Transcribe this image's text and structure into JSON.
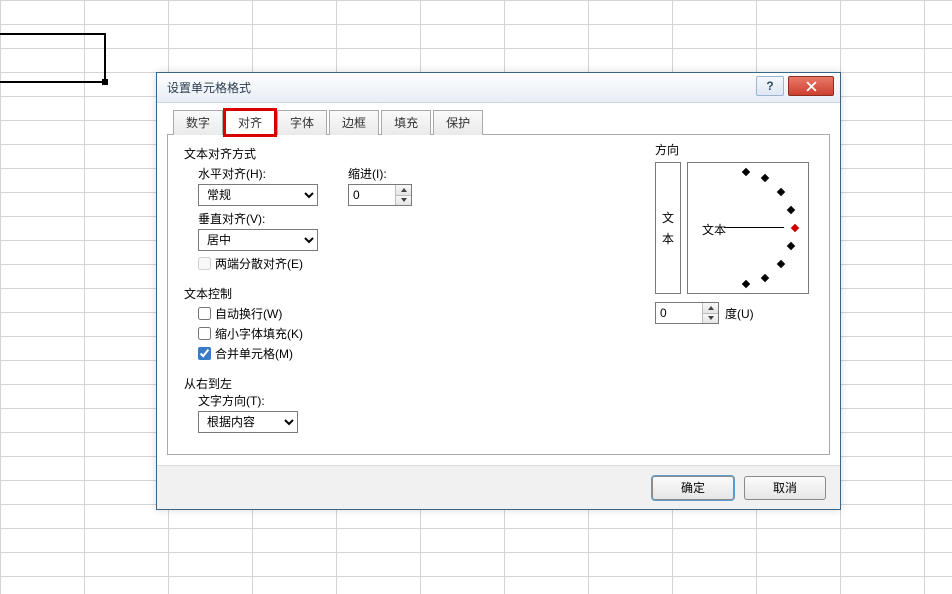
{
  "dialog": {
    "title": "设置单元格格式",
    "tabs": [
      "数字",
      "对齐",
      "字体",
      "边框",
      "填充",
      "保护"
    ],
    "active_tab_index": 1
  },
  "align": {
    "group_label": "文本对齐方式",
    "h_label": "水平对齐(H):",
    "h_value": "常规",
    "indent_label": "缩进(I):",
    "indent_value": "0",
    "v_label": "垂直对齐(V):",
    "v_value": "居中",
    "justify_label": "两端分散对齐(E)",
    "justify_checked": false
  },
  "control": {
    "group_label": "文本控制",
    "wrap_label": "自动换行(W)",
    "wrap_checked": false,
    "shrink_label": "缩小字体填充(K)",
    "shrink_checked": false,
    "merge_label": "合并单元格(M)",
    "merge_checked": true
  },
  "rtl": {
    "group_label": "从右到左",
    "dir_label": "文字方向(T):",
    "dir_value": "根据内容"
  },
  "orient": {
    "group_label": "方向",
    "vtext_char1": "文",
    "vtext_char2": "本",
    "dial_label": "文本",
    "degree_value": "0",
    "degree_label": "度(U)"
  },
  "buttons": {
    "ok": "确定",
    "cancel": "取消"
  }
}
